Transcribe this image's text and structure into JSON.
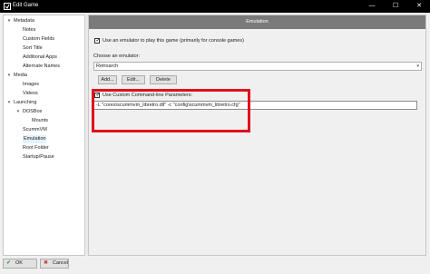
{
  "window": {
    "title": "Edit Game",
    "minimize_glyph": "—",
    "maximize_glyph": "☐",
    "close_glyph": "✕"
  },
  "tree": {
    "items": [
      {
        "label": "Metadata",
        "toggle": "▾"
      },
      {
        "label": "Notes",
        "toggle": ""
      },
      {
        "label": "Custom Fields",
        "toggle": ""
      },
      {
        "label": "Sort Title",
        "toggle": ""
      },
      {
        "label": "Additional Apps",
        "toggle": ""
      },
      {
        "label": "Alternate Names",
        "toggle": ""
      },
      {
        "label": "Media",
        "toggle": "▾"
      },
      {
        "label": "Images",
        "toggle": ""
      },
      {
        "label": "Videos",
        "toggle": ""
      },
      {
        "label": "Launching",
        "toggle": "▾"
      },
      {
        "label": "DOSBox",
        "toggle": "▾"
      },
      {
        "label": "Mounts",
        "toggle": ""
      },
      {
        "label": "ScummVM",
        "toggle": ""
      },
      {
        "label": "Emulation",
        "toggle": ""
      },
      {
        "label": "Root Folder",
        "toggle": ""
      },
      {
        "label": "Startup/Pause",
        "toggle": ""
      }
    ]
  },
  "panel": {
    "header": "Emulation",
    "use_emulator": {
      "checked": true,
      "mark": "✓",
      "label": "Use an emulator to play this game (primarily for console games)"
    },
    "choose_label": "Choose an emulator:",
    "emulator_value": "Retroarch",
    "select_chevron": "▾",
    "add_label": "Add...",
    "edit_label": "Edit...",
    "delete_label": "Delete",
    "custom_cmd": {
      "checked": true,
      "mark": "✓",
      "label": "Use Custom Command-line Parameters:"
    },
    "cmd_value": "-L \"cores\\scummvm_libretro.dll\" -c \"config\\scummvm_libretro.cfg\""
  },
  "footer": {
    "ok_label": "OK",
    "ok_icon": "✔",
    "cancel_label": "Cancel",
    "cancel_icon": "✖"
  },
  "colors": {
    "highlight": "#e0101a",
    "header_bg": "#7a7a7a",
    "selected_bg": "#e5f1fb"
  }
}
